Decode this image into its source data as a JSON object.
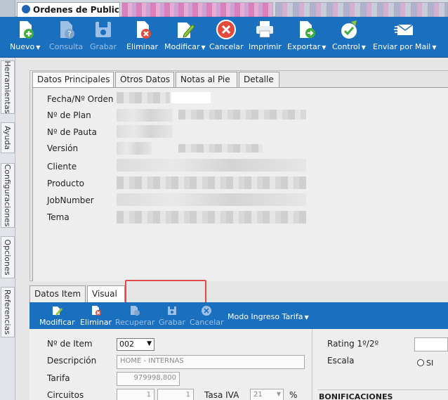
{
  "window": {
    "active_tab_title": "Ordenes de Publicidad"
  },
  "toolbar": {
    "buttons": [
      {
        "label": "Nuevo",
        "icon": "document-add-icon",
        "dropdown": true,
        "disabled": false
      },
      {
        "label": "Consulta",
        "icon": "document-query-icon",
        "dropdown": false,
        "disabled": true
      },
      {
        "label": "Grabar",
        "icon": "save-disk-icon",
        "dropdown": false,
        "disabled": true
      },
      {
        "label": "Eliminar",
        "icon": "document-delete-icon",
        "dropdown": false,
        "disabled": false
      },
      {
        "label": "Modificar",
        "icon": "document-edit-icon",
        "dropdown": true,
        "disabled": false
      },
      {
        "label": "Cancelar",
        "icon": "cancel-icon",
        "dropdown": false,
        "disabled": false
      },
      {
        "label": "Imprimir",
        "icon": "printer-icon",
        "dropdown": false,
        "disabled": false
      },
      {
        "label": "Exportar",
        "icon": "export-icon",
        "dropdown": true,
        "disabled": false
      },
      {
        "label": "Control",
        "icon": "control-check-icon",
        "dropdown": true,
        "disabled": false
      },
      {
        "label": "Enviar por Mail",
        "icon": "mail-icon",
        "dropdown": true,
        "disabled": false
      }
    ]
  },
  "sidebar": {
    "tabs": [
      "Herramientas",
      "Ayuda",
      "Configuraciones",
      "Opciones",
      "Referencias"
    ]
  },
  "main_tabs": [
    "Datos Principales",
    "Otros Datos",
    "Notas al Pie",
    "Detalle"
  ],
  "fields": [
    "Fecha/Nº Orden",
    "Nº de Plan",
    "Nº de Pauta",
    "Versión",
    "Cliente",
    "Producto",
    "JobNumber",
    "Tema"
  ],
  "lower_tabs": [
    "Datos Item",
    "Visual"
  ],
  "item_toolbar": {
    "buttons": [
      {
        "label": "Modificar",
        "icon": "edit-icon",
        "disabled": false
      },
      {
        "label": "Eliminar",
        "icon": "delete-icon",
        "disabled": false
      },
      {
        "label": "Recuperar",
        "icon": "recover-icon",
        "disabled": true
      },
      {
        "label": "Grabar",
        "icon": "save-icon",
        "disabled": true
      },
      {
        "label": "Cancelar",
        "icon": "cancel-icon",
        "disabled": true
      }
    ],
    "mode_label": "Modo Ingreso Tarifa"
  },
  "item_form": {
    "nro_item_label": "Nº de Item",
    "nro_item_value": "002",
    "descripcion_label": "Descripción",
    "descripcion_value": "HOME - INTERNAS",
    "tarifa_label": "Tarifa",
    "tarifa_value": "979998,800",
    "circuitos_label": "Circuitos",
    "circuitos_value_1": "1",
    "circuitos_value_2": "1",
    "tasa_iva_label": "Tasa IVA",
    "tasa_iva_value": "21",
    "percent_sign": "%"
  },
  "right_form": {
    "rating_label": "Rating 1º/2º",
    "escala_label": "Escala",
    "radio_si": "SI",
    "bonificaciones_label": "BONIFICACIONES"
  },
  "colors": {
    "toolbar_blue": "#1b6fbf",
    "highlight_red": "#e04a4a"
  }
}
